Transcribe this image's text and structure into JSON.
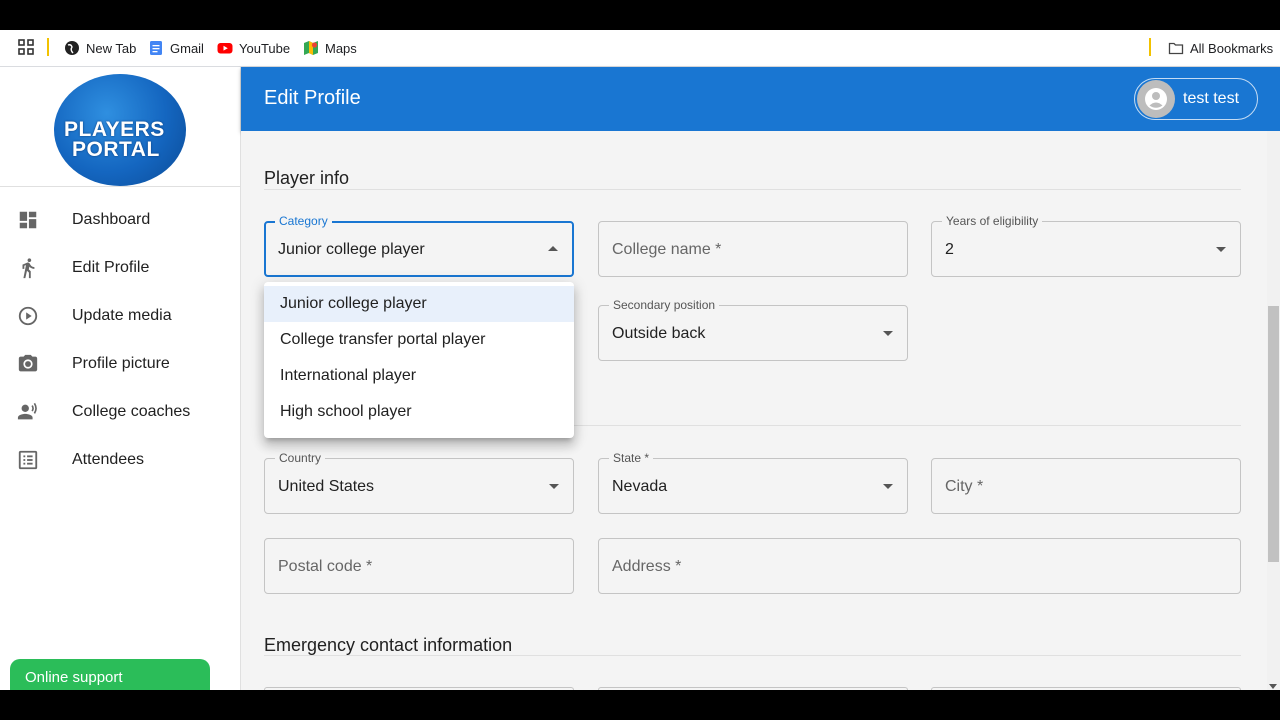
{
  "bookmarks": {
    "items": [
      {
        "label": "New Tab",
        "icon": "globe-icon"
      },
      {
        "label": "Gmail",
        "icon": "docs-icon"
      },
      {
        "label": "YouTube",
        "icon": "youtube-icon"
      },
      {
        "label": "Maps",
        "icon": "maps-icon"
      }
    ],
    "all_bookmarks": "All Bookmarks"
  },
  "logo": {
    "line1": "PLAYERS",
    "line2": "PORTAL"
  },
  "sidebar": {
    "items": [
      {
        "label": "Dashboard",
        "icon": "dashboard-icon"
      },
      {
        "label": "Edit Profile",
        "icon": "runner-icon"
      },
      {
        "label": "Update media",
        "icon": "play-circle-icon"
      },
      {
        "label": "Profile picture",
        "icon": "camera-icon"
      },
      {
        "label": "College coaches",
        "icon": "speaker-person-icon"
      },
      {
        "label": "Attendees",
        "icon": "list-icon"
      }
    ],
    "online_support": "Online support"
  },
  "header": {
    "title": "Edit Profile",
    "user_name": "test test"
  },
  "main": {
    "player_info_title": "Player info",
    "emergency_title": "Emergency contact information",
    "category": {
      "label": "Category",
      "value": "Junior college player"
    },
    "college_name": {
      "placeholder": "College name *"
    },
    "years_eligibility": {
      "label": "Years of eligibility",
      "value": "2"
    },
    "secondary_position": {
      "label": "Secondary position",
      "value": "Outside back"
    },
    "country": {
      "label": "Country",
      "value": "United States"
    },
    "state": {
      "label": "State *",
      "value": "Nevada"
    },
    "city": {
      "placeholder": "City *"
    },
    "postal_code": {
      "placeholder": "Postal code *"
    },
    "address": {
      "placeholder": "Address *"
    }
  },
  "dropdown": {
    "options": [
      "Junior college player",
      "College transfer portal player",
      "International player",
      "High school player"
    ],
    "selected": "Junior college player"
  },
  "colors": {
    "primary": "#1976d2",
    "support": "#2bbd59",
    "selected_option": "#e8f0fb"
  }
}
